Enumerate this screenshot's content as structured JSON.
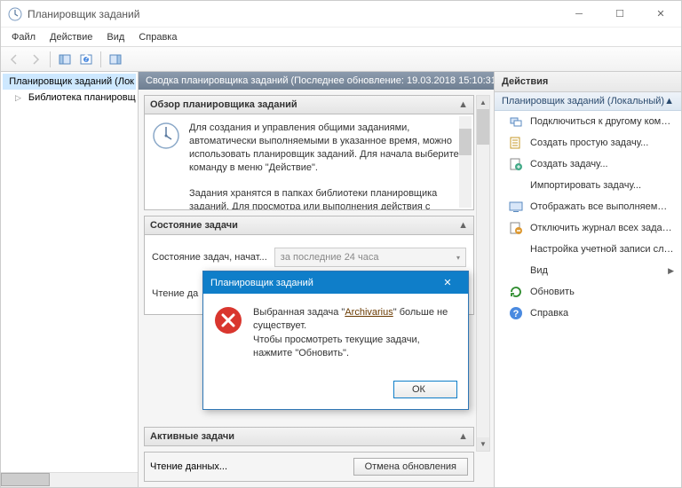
{
  "window": {
    "title": "Планировщик заданий"
  },
  "menu": {
    "file": "Файл",
    "action": "Действие",
    "view": "Вид",
    "help": "Справка"
  },
  "tree": {
    "root": "Планировщик заданий (Лок",
    "library": "Библиотека планировщ"
  },
  "main": {
    "header": "Сводка планировщика заданий (Последнее обновление: 19.03.2018 15:10:31)",
    "overview": {
      "title": "Обзор планировщика заданий",
      "p1": "Для создания и управления общими заданиями, автоматически выполняемыми в указанное время, можно использовать планировщик заданий. Для начала выберите команду в меню \"Действие\".",
      "p2": "Задания хранятся в папках библиотеки планировщика заданий. Для просмотра или выполнения действия с"
    },
    "status": {
      "title": "Состояние задачи",
      "label": "Состояние задач, начат...",
      "combo": "за последние 24 часа",
      "reading": "Чтение да"
    },
    "active": {
      "title": "Активные задачи"
    },
    "footer": {
      "reading": "Чтение данных...",
      "cancel": "Отмена обновления"
    }
  },
  "actions": {
    "pane_title": "Действия",
    "subtitle": "Планировщик заданий (Локальный)",
    "items": [
      {
        "label": "Подключиться к другому комп...",
        "icon": "connect"
      },
      {
        "label": "Создать простую задачу...",
        "icon": "create-basic"
      },
      {
        "label": "Создать задачу...",
        "icon": "create"
      },
      {
        "label": "Импортировать задачу...",
        "icon": "import"
      },
      {
        "label": "Отображать все выполняемые за...",
        "icon": "display"
      },
      {
        "label": "Отключить журнал всех заданий",
        "icon": "disable-log"
      },
      {
        "label": "Настройка учетной записи служ...",
        "icon": "account"
      },
      {
        "label": "Вид",
        "icon": "view",
        "submenu": true
      },
      {
        "label": "Обновить",
        "icon": "refresh"
      },
      {
        "label": "Справка",
        "icon": "help"
      }
    ]
  },
  "dialog": {
    "title": "Планировщик заданий",
    "msg1a": "Выбранная задача \"",
    "msg1b": "Archivarius",
    "msg1c": "\" больше не существует.",
    "msg2": "Чтобы просмотреть текущие задачи, нажмите \"Обновить\".",
    "ok": "ОК"
  }
}
